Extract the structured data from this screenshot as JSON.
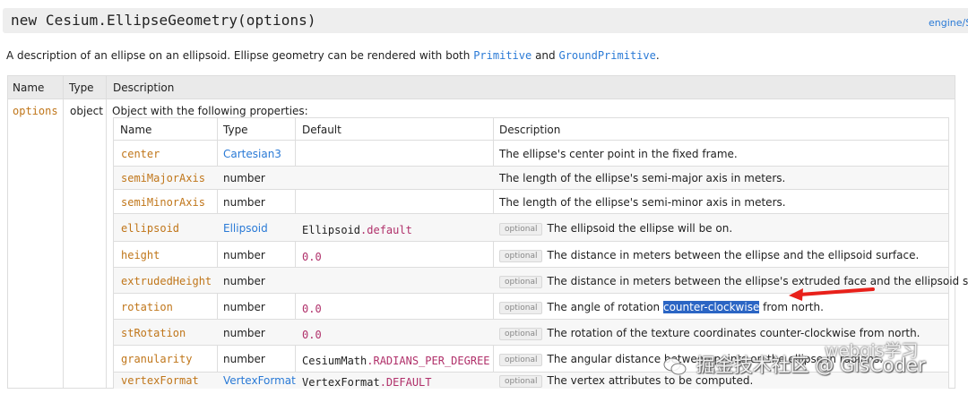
{
  "header": {
    "title": "new Cesium.EllipseGeometry(options)",
    "source_link": "engine/S"
  },
  "description": {
    "text": "A description of an ellipse on an ellipsoid. Ellipse geometry can be rendered with both",
    "link1": "Primitive",
    "conj": "and",
    "link2": "GroundPrimitive",
    "end": "."
  },
  "params_table": {
    "headers": [
      "Name",
      "Type",
      "Description"
    ],
    "param": {
      "name": "options",
      "type": "object",
      "description": "Object with the following properties:"
    }
  },
  "props_table": {
    "headers": [
      "Name",
      "Type",
      "Default",
      "Description"
    ],
    "optional_label": "optional",
    "rows": [
      {
        "name": "center",
        "type": "Cartesian3",
        "type_link": true,
        "default": "",
        "optional": false,
        "desc": "The ellipse's center point in the fixed frame."
      },
      {
        "name": "semiMajorAxis",
        "type": "number",
        "type_link": false,
        "default": "",
        "optional": false,
        "desc": "The length of the ellipse's semi-major axis in meters."
      },
      {
        "name": "semiMinorAxis",
        "type": "number",
        "type_link": false,
        "default": "",
        "optional": false,
        "desc": "The length of the ellipse's semi-minor axis in meters."
      },
      {
        "name": "ellipsoid",
        "type": "Ellipsoid",
        "type_link": true,
        "default_prefix": "Ellipsoid",
        "default_suffix": ".default",
        "optional": true,
        "desc": "The ellipsoid the ellipse will be on."
      },
      {
        "name": "height",
        "type": "number",
        "type_link": false,
        "default_num": "0.0",
        "optional": true,
        "desc": "The distance in meters between the ellipse and the ellipsoid surface."
      },
      {
        "name": "extrudedHeight",
        "type": "number",
        "type_link": false,
        "default": "",
        "optional": true,
        "desc": "The distance in meters between the ellipse's extruded face and the ellipsoid surface."
      },
      {
        "name": "rotation",
        "type": "number",
        "type_link": false,
        "default_num": "0.0",
        "optional": true,
        "desc_pre": "The angle of rotation ",
        "desc_hl": "counter-clockwise",
        "desc_post": " from north."
      },
      {
        "name": "stRotation",
        "type": "number",
        "type_link": false,
        "default_num": "0.0",
        "optional": true,
        "desc": "The rotation of the texture coordinates counter-clockwise from north."
      },
      {
        "name": "granularity",
        "type": "number",
        "type_link": false,
        "default_prefix": "CesiumMath",
        "default_suffix": ".RADIANS_PER_DEGREE",
        "optional": true,
        "desc": "The angular distance between points on the ellipse in radians."
      },
      {
        "name": "vertexFormat",
        "type": "VertexFormat",
        "type_link": true,
        "default_prefix": "VertexFormat",
        "default_suffix": ".DEFAULT",
        "optional": true,
        "desc": "The vertex attributes to be computed."
      }
    ]
  },
  "watermark": {
    "text": "掘金技术社区 @ GisCoder",
    "overlay_text": "webgis学习"
  },
  "colors": {
    "link": "#2a7ad6",
    "param_name": "#c0761a",
    "literal": "#b0306a",
    "highlight": "#2b65c4",
    "arrow": "#e8201a"
  }
}
